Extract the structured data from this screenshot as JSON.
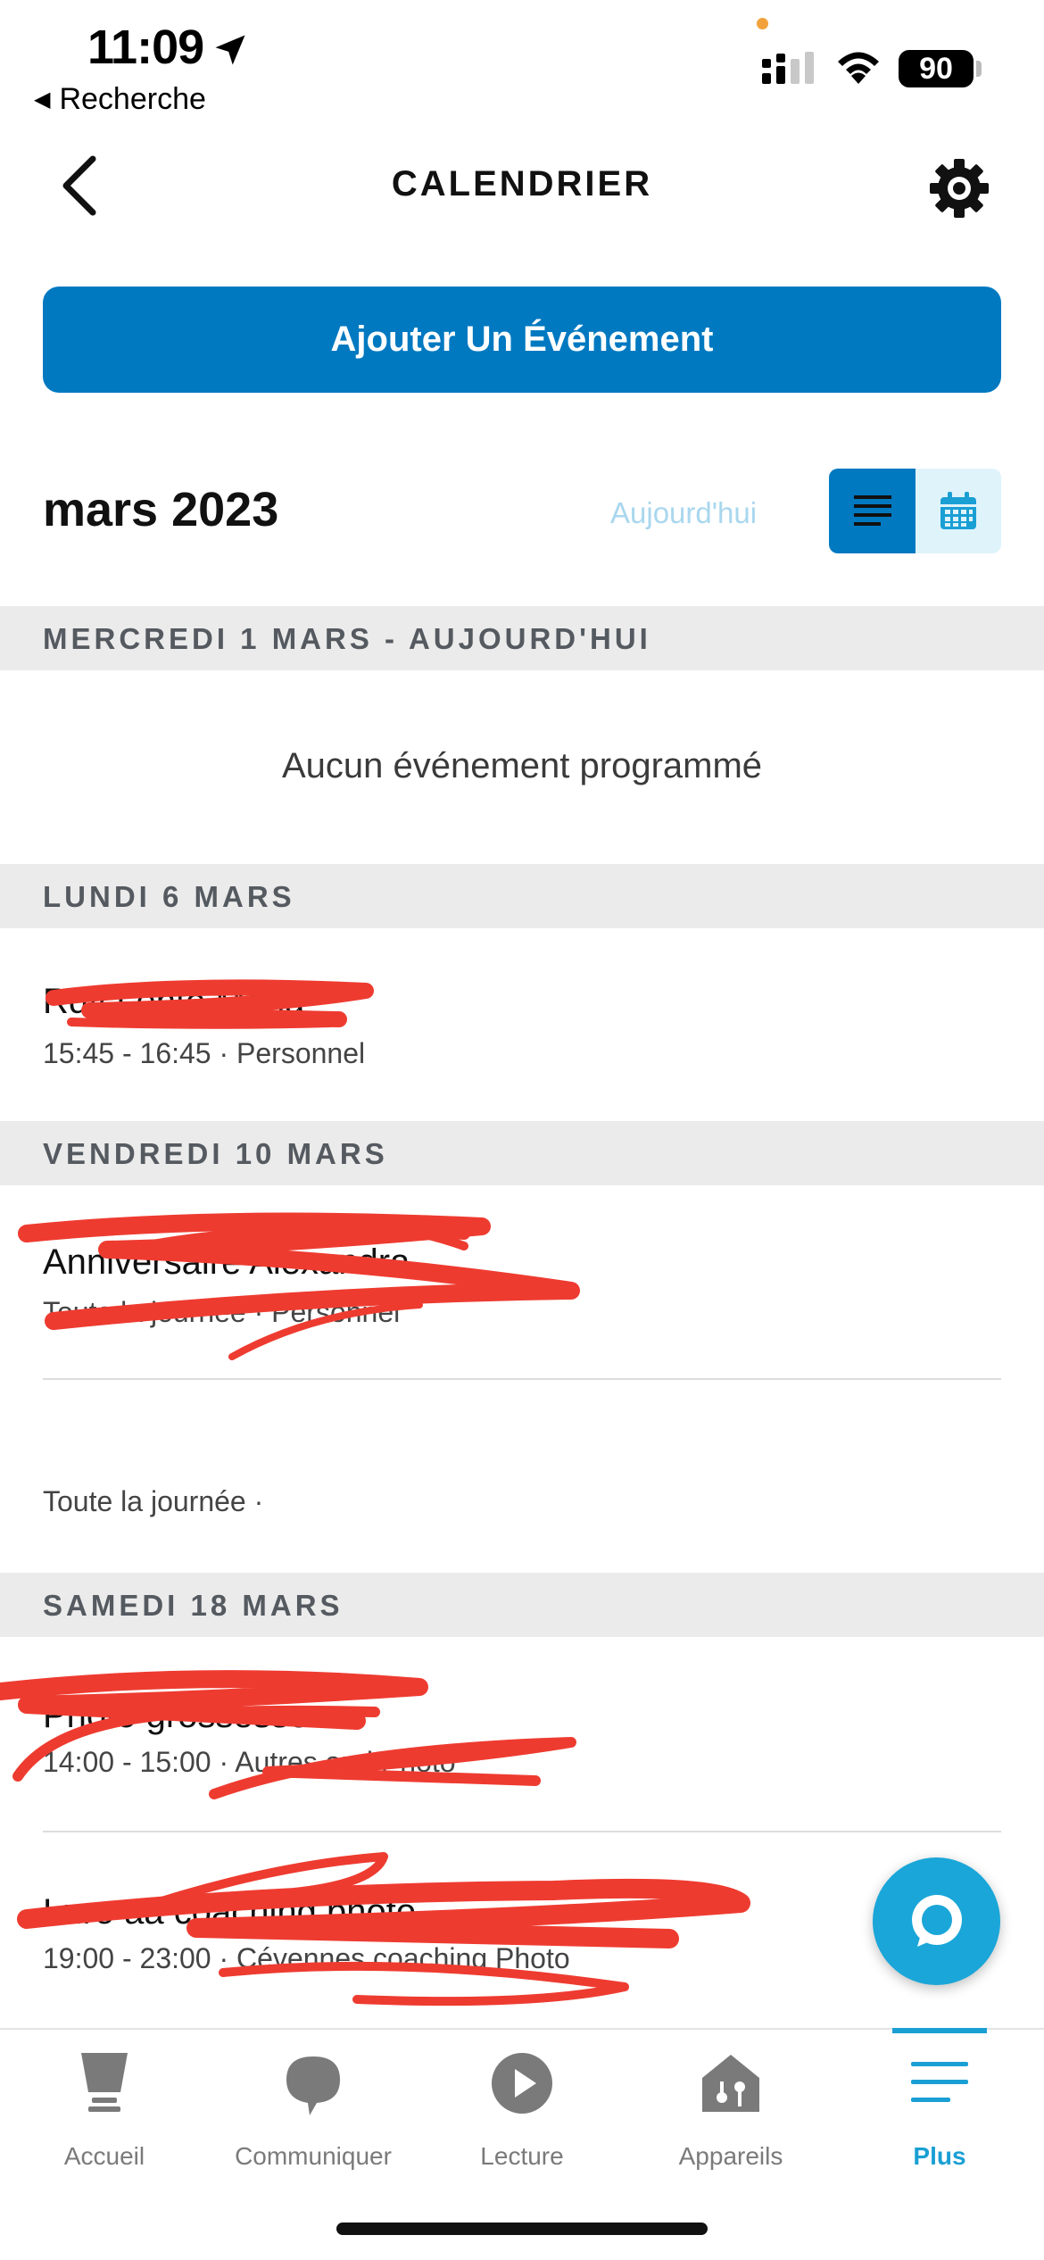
{
  "status_bar": {
    "time": "11:09",
    "back_app_label": "Recherche",
    "battery": "90"
  },
  "header": {
    "title": "CALENDRIER"
  },
  "add_event_label": "Ajouter Un Événement",
  "month_label": "mars 2023",
  "today_label": "Aujourd'hui",
  "colors": {
    "primary": "#0079c1",
    "accent": "#1aa6d8",
    "today_link": "#a9d7ee",
    "day_header_bg": "#ebebeb",
    "redaction": "#ee3b30"
  },
  "days": [
    {
      "header": "MERCREDI 1 MARS - AUJOURD'HUI",
      "empty_text": "Aucun événement programmé"
    },
    {
      "header": "LUNDI 6 MARS",
      "events": [
        {
          "title": "Rdv Lente Maria",
          "subtitle": "15:45 - 16:45 · Personnel"
        }
      ]
    },
    {
      "header": "VENDREDI 10 MARS",
      "events": [
        {
          "title": "Anniversaire Alexandra",
          "subtitle": "Toute la journée · Personnel"
        },
        {
          "title": "",
          "subtitle": "Toute la journée ·"
        }
      ]
    },
    {
      "header": "SAMEDI 18 MARS",
      "events": [
        {
          "title": "Photo grossesse",
          "subtitle": "14:00 - 15:00 · Autres and Photo"
        },
        {
          "title": "Luro aa coaching photo",
          "subtitle": "19:00 - 23:00 · Cévennes coaching Photo"
        }
      ]
    }
  ],
  "tabs": [
    {
      "label": "Accueil",
      "icon": "home-device-icon"
    },
    {
      "label": "Communiquer",
      "icon": "chat-bubble-icon"
    },
    {
      "label": "Lecture",
      "icon": "play-icon"
    },
    {
      "label": "Appareils",
      "icon": "smart-home-icon"
    },
    {
      "label": "Plus",
      "icon": "menu-icon",
      "active": true
    }
  ]
}
